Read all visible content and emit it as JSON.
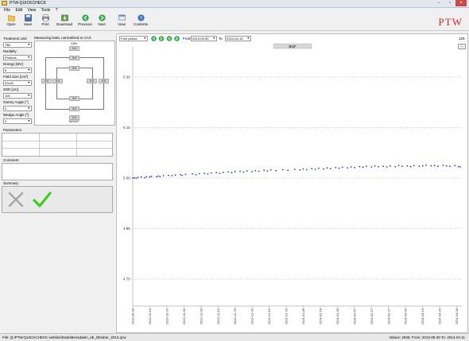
{
  "window": {
    "title": "PTW-QUICKCHECK",
    "controls": [
      "minimize-icon",
      "maximize-icon",
      "close-icon"
    ]
  },
  "menu": [
    "File",
    "Edit",
    "View",
    "Tools",
    "?"
  ],
  "toolbar": {
    "buttons": [
      {
        "label": "Open",
        "icon": "folder-icon"
      },
      {
        "label": "Save",
        "icon": "disk-icon"
      },
      {
        "label": "Print",
        "icon": "printer-icon"
      },
      {
        "label": "Download",
        "icon": "download-icon"
      },
      {
        "label": "Previous",
        "icon": "arrow-left-icon"
      },
      {
        "label": "Next",
        "icon": "arrow-right-icon"
      },
      {
        "label": "View",
        "icon": "view-icon"
      },
      {
        "label": "Contents",
        "icon": "help-icon"
      }
    ],
    "logo": "PTW"
  },
  "left": {
    "treatment_unit": {
      "label": "Treatment Unit",
      "value": "TB2"
    },
    "modality": {
      "label": "Modality",
      "value": "Photons"
    },
    "energy": {
      "label": "Energy [MV]",
      "value": "6"
    },
    "field_size": {
      "label": "Field Size [cm²]",
      "value": "20x20"
    },
    "ssd": {
      "label": "SSD [cm]",
      "value": "100"
    },
    "gantry_angle": {
      "label": "Gantry Angle [°]",
      "value": "0"
    },
    "wedge_angle": {
      "label": "Wedge Angle [°]",
      "value": "0"
    },
    "measuring": {
      "title": "Measuring Data, normalized to CAX",
      "gun": "GUN",
      "target": "TARGET",
      "cells": [
        "0.0",
        "0.0",
        "0.0",
        "0.0",
        "0.0",
        "0.0",
        "0.0",
        "0.0",
        "0.0",
        "0.0"
      ]
    },
    "parameters_label": "Parameters",
    "comment_label": "Comment",
    "summary_label": "Summary"
  },
  "plot": {
    "period": "Free period",
    "from_label": "From",
    "from_value": "2013-09-30",
    "to_label": "To",
    "to_value": "2014-04-10",
    "count": "129",
    "colors": {
      "points": "#3333dd",
      "grid": "#b0b0b0"
    }
  },
  "chart_data": {
    "type": "scatter",
    "title": "BQF",
    "xlabel": "",
    "ylabel": "",
    "ylim": [
      4.62,
      5.38
    ],
    "yticks": [
      5.3,
      5.15,
      5.0,
      4.85,
      4.7
    ],
    "ytick_labels": [
      "5.30",
      "5.15",
      "5.00",
      "4.85",
      "4.70"
    ],
    "grid": "dashed horizontal",
    "x_start": "2013-09-30",
    "x_end": "2014-04-11",
    "xtick_labels": [
      "2013-09-30",
      "2013-10-10",
      "2013-10-20",
      "2013-10-30",
      "2013-11-09",
      "2013-11-19",
      "2013-11-29",
      "2013-12-09",
      "2013-12-19",
      "2013-12-29",
      "2014-01-08",
      "2014-01-18",
      "2014-01-28",
      "2014-02-07",
      "2014-02-17",
      "2014-02-27",
      "2014-03-09",
      "2014-03-19",
      "2014-03-29",
      "2014-04-08"
    ],
    "points": [
      [
        "2013-09-30",
        5.0
      ],
      [
        "2013-10-01",
        5.001
      ],
      [
        "2013-10-02",
        4.999
      ],
      [
        "2013-10-03",
        5.002
      ],
      [
        "2013-10-05",
        5.003
      ],
      [
        "2013-10-07",
        5.001
      ],
      [
        "2013-10-08",
        5.004
      ],
      [
        "2013-10-10",
        5.003
      ],
      [
        "2013-10-11",
        5.005
      ],
      [
        "2013-10-14",
        5.004
      ],
      [
        "2013-10-15",
        5.006
      ],
      [
        "2013-10-16",
        5.004
      ],
      [
        "2013-10-18",
        5.007
      ],
      [
        "2013-10-21",
        5.008
      ],
      [
        "2013-10-23",
        5.007
      ],
      [
        "2013-10-25",
        5.009
      ],
      [
        "2013-10-28",
        5.01
      ],
      [
        "2013-10-29",
        5.008
      ],
      [
        "2013-10-31",
        5.011
      ],
      [
        "2013-11-04",
        5.012
      ],
      [
        "2013-11-06",
        5.01
      ],
      [
        "2013-11-08",
        5.013
      ],
      [
        "2013-11-11",
        5.014
      ],
      [
        "2013-11-13",
        5.012
      ],
      [
        "2013-11-15",
        5.015
      ],
      [
        "2013-11-18",
        5.016
      ],
      [
        "2013-11-20",
        5.014
      ],
      [
        "2013-11-22",
        5.017
      ],
      [
        "2013-11-25",
        5.018
      ],
      [
        "2013-11-27",
        5.016
      ],
      [
        "2013-11-29",
        5.019
      ],
      [
        "2013-12-02",
        5.02
      ],
      [
        "2013-12-04",
        5.018
      ],
      [
        "2013-12-06",
        5.021
      ],
      [
        "2013-12-09",
        5.019
      ],
      [
        "2013-12-11",
        5.022
      ],
      [
        "2013-12-13",
        5.02
      ],
      [
        "2013-12-16",
        5.023
      ],
      [
        "2013-12-18",
        5.021
      ],
      [
        "2013-12-20",
        5.024
      ],
      [
        "2013-12-23",
        5.022
      ],
      [
        "2013-12-27",
        5.025
      ],
      [
        "2013-12-30",
        5.023
      ],
      [
        "2014-01-03",
        5.026
      ],
      [
        "2014-01-06",
        5.024
      ],
      [
        "2014-01-08",
        5.027
      ],
      [
        "2014-01-10",
        5.025
      ],
      [
        "2014-01-13",
        5.028
      ],
      [
        "2014-01-15",
        5.026
      ],
      [
        "2014-01-17",
        5.029
      ],
      [
        "2014-01-20",
        5.027
      ],
      [
        "2014-01-22",
        5.03
      ],
      [
        "2014-01-24",
        5.028
      ],
      [
        "2014-01-27",
        5.031
      ],
      [
        "2014-01-29",
        5.029
      ],
      [
        "2014-01-31",
        5.032
      ],
      [
        "2014-02-03",
        5.03
      ],
      [
        "2014-02-05",
        5.033
      ],
      [
        "2014-02-07",
        5.031
      ],
      [
        "2014-02-10",
        5.034
      ],
      [
        "2014-02-12",
        5.032
      ],
      [
        "2014-02-14",
        5.035
      ],
      [
        "2014-02-17",
        5.033
      ],
      [
        "2014-02-19",
        5.036
      ],
      [
        "2014-02-21",
        5.034
      ],
      [
        "2014-02-24",
        5.035
      ],
      [
        "2014-02-26",
        5.033
      ],
      [
        "2014-02-28",
        5.036
      ],
      [
        "2014-03-03",
        5.034
      ],
      [
        "2014-03-05",
        5.037
      ],
      [
        "2014-03-07",
        5.035
      ],
      [
        "2014-03-10",
        5.036
      ],
      [
        "2014-03-12",
        5.034
      ],
      [
        "2014-03-14",
        5.037
      ],
      [
        "2014-03-17",
        5.035
      ],
      [
        "2014-03-19",
        5.036
      ],
      [
        "2014-03-21",
        5.038
      ],
      [
        "2014-03-24",
        5.036
      ],
      [
        "2014-03-26",
        5.037
      ],
      [
        "2014-03-28",
        5.035
      ],
      [
        "2014-03-31",
        5.038
      ],
      [
        "2014-04-02",
        5.036
      ],
      [
        "2014-04-04",
        5.035
      ],
      [
        "2014-04-07",
        5.037
      ],
      [
        "2014-04-09",
        5.034
      ],
      [
        "2014-04-10",
        5.033
      ]
    ]
  },
  "status": {
    "file": "File: Q:\\PTW-QUICKCHECK webline\\Data\\Messdaten_ab_Oktober_2013.qcw",
    "values": "Values: 2838; From: 2013-09-30 To: 2014-04-11"
  }
}
